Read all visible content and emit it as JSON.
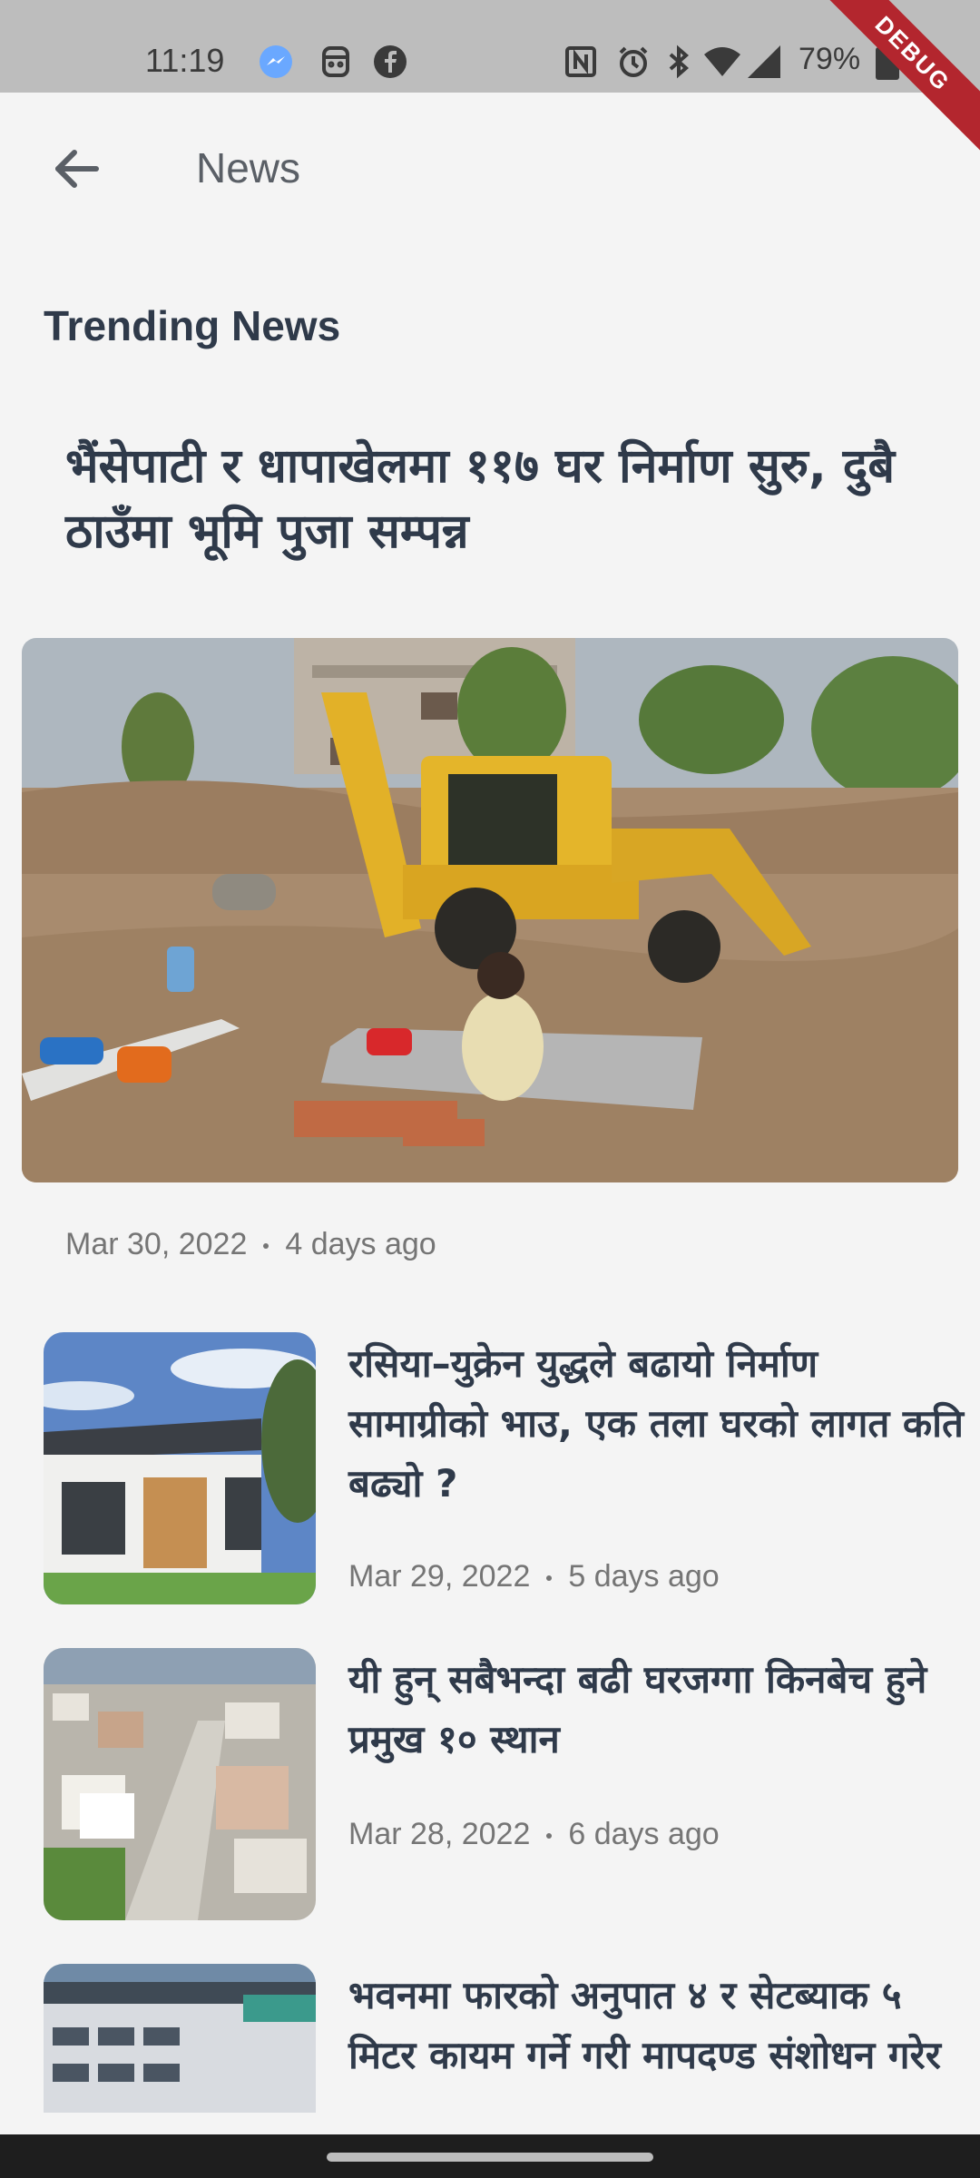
{
  "status_bar": {
    "time": "11:19",
    "battery": "79%",
    "icons": [
      "messenger-icon",
      "face-id-icon",
      "facebook-icon",
      "nfc-icon",
      "alarm-icon",
      "bluetooth-icon",
      "wifi-icon",
      "signal-icon",
      "battery-icon"
    ],
    "debug_label": "DEBUG"
  },
  "app_bar": {
    "title": "News",
    "back_icon": "arrow-left-icon"
  },
  "section_title": "Trending News",
  "featured": {
    "headline": "भैंसेपाटी र धापाखेलमा ११७ घर निर्माण सुरु, दुबै ठाउँमा भूमि पुजा सम्पन्न",
    "date": "Mar 30, 2022",
    "ago": "4 days ago"
  },
  "articles": [
    {
      "title": "रसिया–युक्रेन युद्धले बढायो निर्माण सामाग्रीको भाउ, एक तला घरको लागत कति बढ्यो ?",
      "date": "Mar 29, 2022",
      "ago": "5 days ago"
    },
    {
      "title": "यी हुन् सबैभन्दा बढी घरजग्गा किनबेच हुने प्रमुख १० स्थान",
      "date": "Mar 28, 2022",
      "ago": "6 days ago"
    },
    {
      "title": "भवनमा फारको अनुपात ४ र सेटब्याक ५ मिटर कायम गर्ने गरी मापदण्ड संशोधन गरेर",
      "date": "",
      "ago": ""
    }
  ],
  "colors": {
    "background": "#f4f4f4",
    "headline": "#2f3a4a",
    "meta": "#757575",
    "status_bar": "#bdbdbd",
    "debug": "#b3262e"
  }
}
